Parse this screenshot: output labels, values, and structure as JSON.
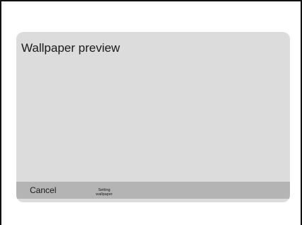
{
  "dialog": {
    "title": "Wallpaper preview",
    "cancel_label": "Cancel",
    "set_label_line1": "Setting",
    "set_label_line2": "wallpaper"
  },
  "colors": {
    "dialog_background": "#dcdcdc",
    "button_bar_background": "#b4b4b4",
    "frame_border": "#111111"
  }
}
